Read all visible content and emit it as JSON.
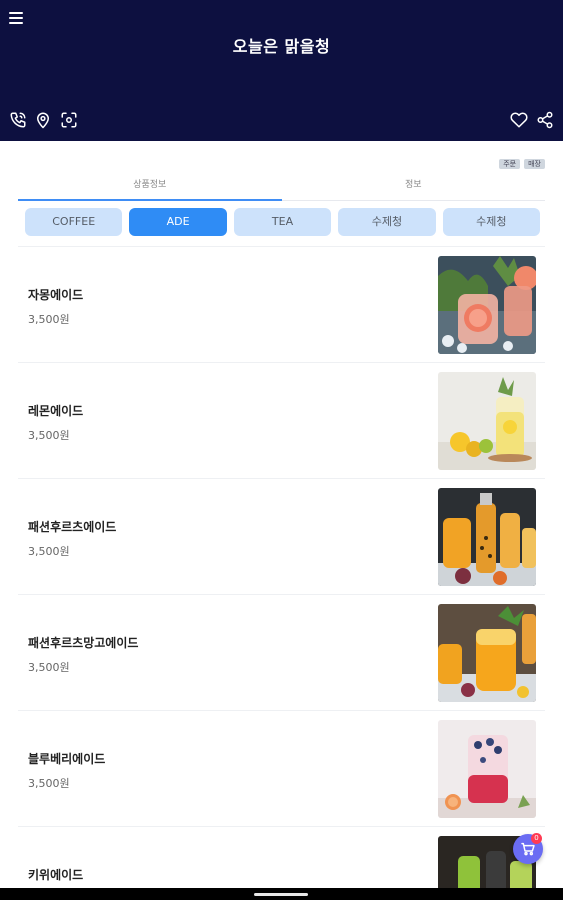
{
  "header": {
    "store_name": "오늘은 맑을청"
  },
  "badges": [
    "주문",
    "매장"
  ],
  "tabs": [
    {
      "label": "상품정보",
      "active": true
    },
    {
      "label": "정보",
      "active": false
    }
  ],
  "categories": [
    {
      "label": "COFFEE",
      "active": false
    },
    {
      "label": "ADE",
      "active": true
    },
    {
      "label": "TEA",
      "active": false
    },
    {
      "label": "수제청",
      "active": false
    },
    {
      "label": "수제청",
      "active": false
    }
  ],
  "products": [
    {
      "name": "자몽에이드",
      "price": "3,500원",
      "image": "grapefruit-ade"
    },
    {
      "name": "레몬에이드",
      "price": "3,500원",
      "image": "lemon-ade"
    },
    {
      "name": "패션후르츠에이드",
      "price": "3,500원",
      "image": "passionfruit-ade"
    },
    {
      "name": "패션후르츠망고에이드",
      "price": "3,500원",
      "image": "passionfruit-mango-ade"
    },
    {
      "name": "블루베리에이드",
      "price": "3,500원",
      "image": "blueberry-ade"
    },
    {
      "name": "키위에이드",
      "price": "",
      "image": "kiwi-ade"
    }
  ],
  "cart": {
    "count": "0"
  },
  "colors": {
    "header_bg": "#0d1040",
    "accent": "#2f8cf5",
    "chip_bg": "#cde2fb",
    "cart_fab": "#6a6cf3",
    "cart_badge": "#ff3b53"
  },
  "icons": [
    "menu-icon",
    "call-icon",
    "location-pin-icon",
    "scan-icon",
    "heart-icon",
    "share-icon",
    "cart-icon"
  ]
}
